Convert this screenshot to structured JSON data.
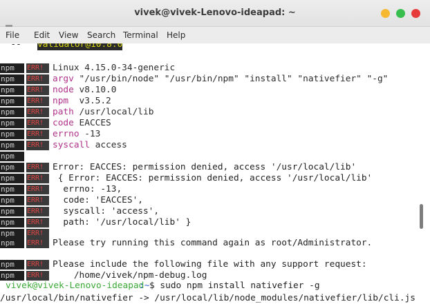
{
  "window": {
    "title": "vivek@vivek-Lenovo-ideapad: ~"
  },
  "menu": [
    "File",
    "Edit",
    "View",
    "Search",
    "Terminal",
    "Help"
  ],
  "terminal": {
    "top_partial": {
      "prefix": "  -- ",
      "highlight": "validator@10.8.0"
    },
    "tags": {
      "npm": "npm",
      "err": "ERR!"
    },
    "env_lines": [
      {
        "key": "",
        "value": "Linux 4.15.0-34-generic"
      },
      {
        "key": "argv",
        "value": " \"/usr/bin/node\" \"/usr/bin/npm\" \"install\" \"nativefier\" \"-g\""
      },
      {
        "key": "node",
        "value": " v8.10.0"
      },
      {
        "key": "npm ",
        "value": " v3.5.2"
      },
      {
        "key": "path",
        "value": " /usr/local/lib"
      },
      {
        "key": "code",
        "value": " EACCES"
      },
      {
        "key": "errno",
        "value": " -13"
      },
      {
        "key": "syscall",
        "value": " access"
      }
    ],
    "error_lines": [
      "Error: EACCES: permission denied, access '/usr/local/lib'",
      " { Error: EACCES: permission denied, access '/usr/local/lib'",
      "  errno: -13,",
      "  code: 'EACCES',",
      "  syscall: 'access',",
      "  path: '/usr/local/lib' }"
    ],
    "root_line": "Please try running this command again as root/Administrator.",
    "support_lines": [
      "Please include the following file with any support request:",
      "    /home/vivek/npm-debug.log"
    ],
    "prompt": {
      "user_host": "vivek@vivek-Lenovo-ideapad",
      "path": ":~",
      "command": "$ sudo npm install nativefier -g"
    },
    "bottom_partial": "/usr/local/bin/nativefier -> /usr/local/lib/node_modules/nativefier/lib/cli.js"
  }
}
